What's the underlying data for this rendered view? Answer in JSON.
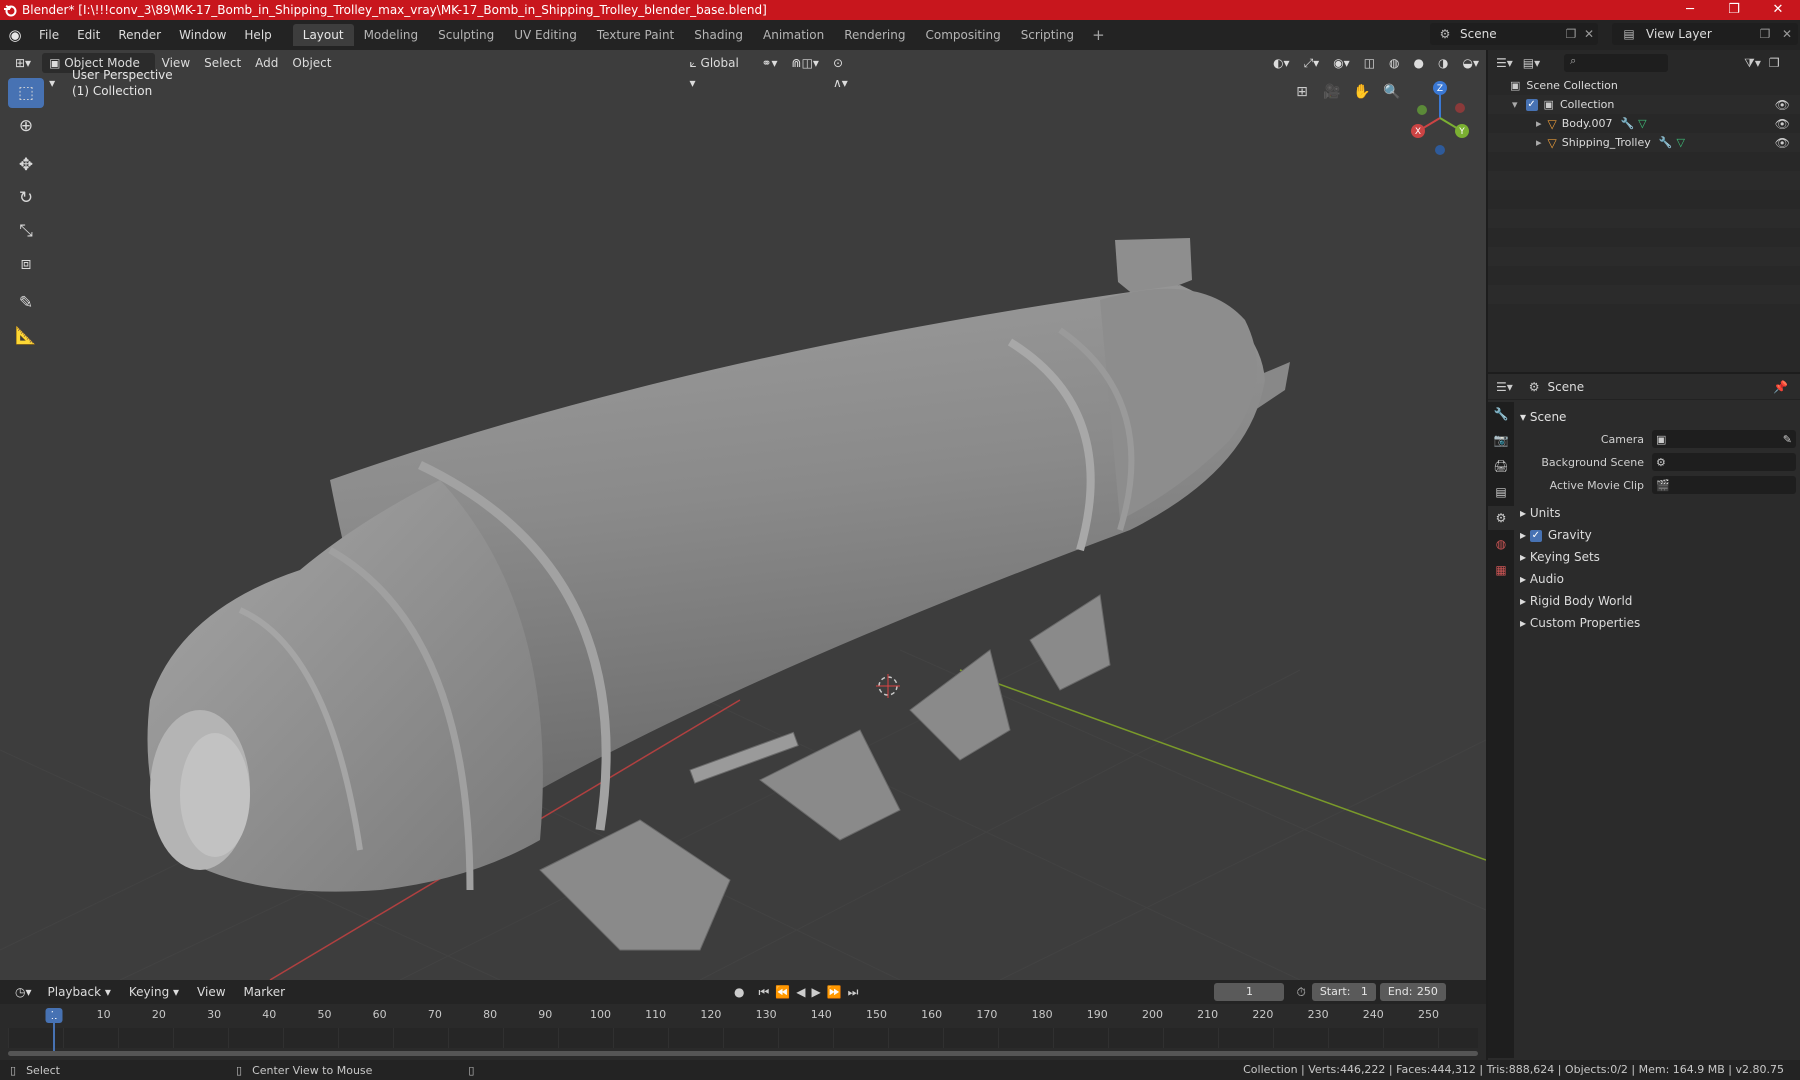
{
  "window": {
    "title": "Blender* [I:\\!!!conv_3\\89\\MK-17_Bomb_in_Shipping_Trolley_max_vray\\MK-17_Bomb_in_Shipping_Trolley_blender_base.blend]",
    "minimize": "─",
    "maximize": "❐",
    "close": "✕"
  },
  "menu": {
    "file": "File",
    "edit": "Edit",
    "render": "Render",
    "window": "Window",
    "help": "Help"
  },
  "workspaces": [
    "Layout",
    "Modeling",
    "Sculpting",
    "UV Editing",
    "Texture Paint",
    "Shading",
    "Animation",
    "Rendering",
    "Compositing",
    "Scripting"
  ],
  "workspace_add": "+",
  "scene_selector": {
    "value": "Scene"
  },
  "view_layer_selector": {
    "value": "View Layer"
  },
  "viewport": {
    "mode": "Object Mode",
    "menus": {
      "view": "View",
      "select": "Select",
      "add": "Add",
      "object": "Object"
    },
    "transform_orientation": "Global",
    "overlay_line1": "User Perspective",
    "overlay_line2": "(1) Collection",
    "gizmo": {
      "x": "X",
      "y": "Y",
      "z": "Z"
    }
  },
  "outliner": {
    "search_placeholder": "",
    "scene_collection": "Scene Collection",
    "collection": "Collection",
    "objects": [
      "Body.007",
      "Shipping_Trolley"
    ]
  },
  "properties": {
    "context": "Scene",
    "section": "Scene",
    "camera_label": "Camera",
    "background_scene_label": "Background Scene",
    "active_movie_clip_label": "Active Movie Clip",
    "panels": [
      "Units",
      "Gravity",
      "Keying Sets",
      "Audio",
      "Rigid Body World",
      "Custom Properties"
    ],
    "gravity_checked": true
  },
  "timeline": {
    "menus": {
      "playback": "Playback",
      "keying": "Keying",
      "view": "View",
      "marker": "Marker"
    },
    "current_frame": "1",
    "start_label": "Start:",
    "start": "1",
    "end_label": "End:",
    "end": "250",
    "ticks": [
      "1",
      "10",
      "20",
      "30",
      "40",
      "50",
      "60",
      "70",
      "80",
      "90",
      "100",
      "110",
      "120",
      "130",
      "140",
      "150",
      "160",
      "170",
      "180",
      "190",
      "200",
      "210",
      "220",
      "230",
      "240",
      "250"
    ]
  },
  "statusbar": {
    "select": "Select",
    "center_view": "Center View to Mouse",
    "stats": "Collection | Verts:446,222 | Faces:444,312 | Tris:888,624 | Objects:0/2 | Mem: 164.9 MB | v2.80.75"
  },
  "colors": {
    "titlebar": "#c8161d",
    "accent": "#4772b3",
    "viewport_bg": "#3d3d3d",
    "axis_x": "#b04040",
    "axis_y": "#7a9a2a"
  }
}
